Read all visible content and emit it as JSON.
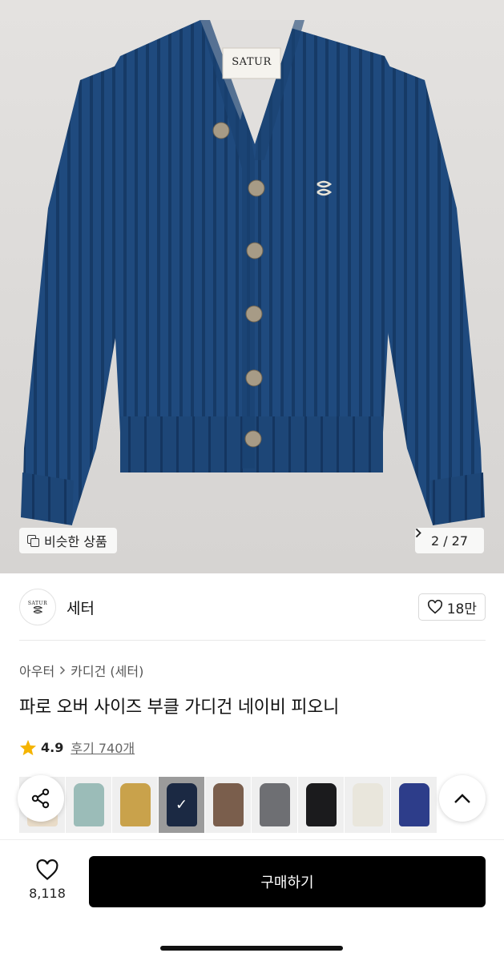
{
  "hero": {
    "garment_label": "SATUR",
    "similar_label": "비슷한 상품",
    "pager_text": "2 / 27"
  },
  "brand": {
    "logo_text": "SATUR",
    "name": "세터",
    "like_count": "18만"
  },
  "breadcrumb": {
    "category": "아우터",
    "subcategory": "카디건 (세터)"
  },
  "product": {
    "title": "파로 오버 사이즈 부클 가디건 네이비 피오니",
    "rating": "4.9",
    "review_text": "후기 740개"
  },
  "colors": {
    "accent_star": "#f5b400",
    "swatches": [
      {
        "name": "model",
        "color": "#e9dcc8"
      },
      {
        "name": "mint",
        "color": "#9bbcb8"
      },
      {
        "name": "mustard",
        "color": "#c9a24b"
      },
      {
        "name": "navy",
        "color": "#2a3f68",
        "selected": true
      },
      {
        "name": "brown",
        "color": "#7a5e4c"
      },
      {
        "name": "gray",
        "color": "#6e6f73"
      },
      {
        "name": "black",
        "color": "#1b1b1d"
      },
      {
        "name": "ivory",
        "color": "#e9e6dc"
      },
      {
        "name": "blue",
        "color": "#2d3d8a"
      }
    ]
  },
  "bottom_bar": {
    "wish_count": "8,118",
    "buy_label": "구매하기"
  }
}
